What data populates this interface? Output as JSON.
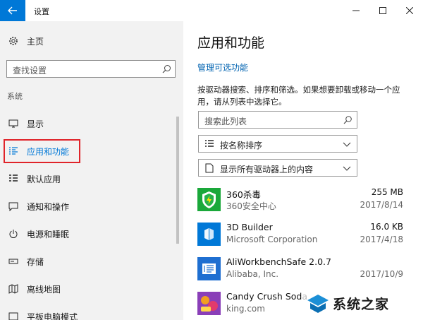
{
  "window": {
    "title": "设置",
    "controls": [
      "minimize-icon",
      "maximize-icon",
      "close-icon"
    ]
  },
  "sidebar": {
    "home_label": "主页",
    "search_placeholder": "查找设置",
    "section_label": "系统",
    "items": [
      {
        "label": "显示",
        "icon": "monitor-icon"
      },
      {
        "label": "应用和功能",
        "icon": "apps-list-icon",
        "selected": true
      },
      {
        "label": "默认应用",
        "icon": "default-apps-icon"
      },
      {
        "label": "通知和操作",
        "icon": "notification-icon"
      },
      {
        "label": "电源和睡眠",
        "icon": "power-icon"
      },
      {
        "label": "存储",
        "icon": "storage-icon"
      },
      {
        "label": "离线地图",
        "icon": "map-icon"
      },
      {
        "label": "平板电脑模式",
        "icon": "tablet-icon"
      }
    ]
  },
  "main": {
    "title": "应用和功能",
    "manage_link": "管理可选功能",
    "description": "按驱动器搜索、排序和筛选。如果想要卸载或移动一个应用，请从列表中选择它。",
    "search_placeholder": "搜索此列表",
    "sort_label": "按名称排序",
    "filter_label": "显示所有驱动器上的内容",
    "apps": [
      {
        "name": "360杀毒",
        "publisher": "360安全中心",
        "size": "255 MB",
        "date": "2017/8/14",
        "icon": "shield-icon",
        "color": "#1aa83a"
      },
      {
        "name": "3D Builder",
        "publisher": "Microsoft Corporation",
        "size": "16.0 KB",
        "date": "2017/4/18",
        "icon": "cube-icon",
        "color": "#0078d7"
      },
      {
        "name": "AliWorkbenchSafe 2.0.7",
        "publisher": "Alibaba, Inc.",
        "size": "",
        "date": "2017/10/9",
        "icon": "workbench-icon",
        "color": "#1f6fd1"
      },
      {
        "name": "Candy Crush Soda",
        "publisher": "king.com",
        "size": "",
        "date": "",
        "icon": "candy-icon",
        "color": "#8a3fb8"
      }
    ]
  },
  "watermark": {
    "text": "系统之家"
  },
  "colors": {
    "accent": "#0078d7",
    "link": "#0063b1",
    "highlight": "#e0242a",
    "sidebar_bg": "#f2f2f2"
  }
}
